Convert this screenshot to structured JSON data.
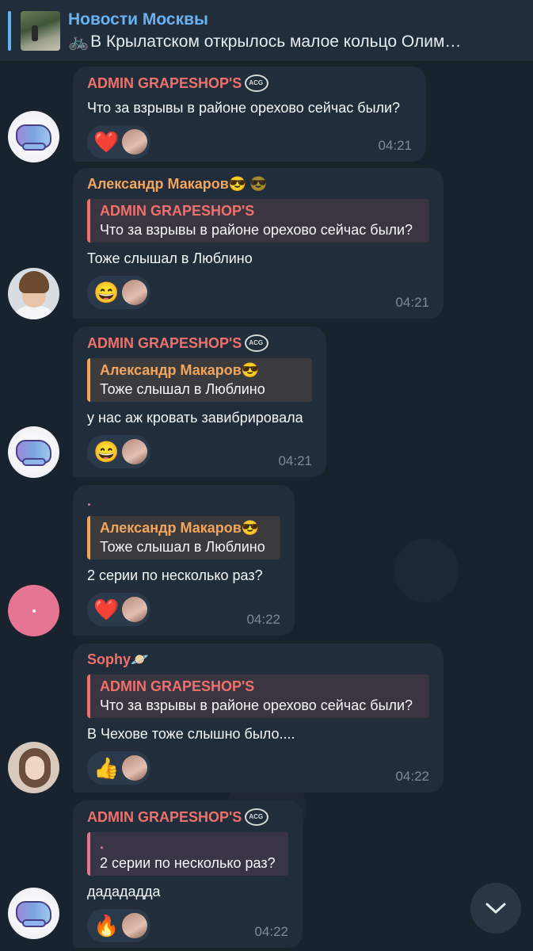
{
  "pinned": {
    "title": "Новости Москвы",
    "subtitle": "В Крылатском открылось малое кольцо Олим…",
    "icon": "bicycle-icon"
  },
  "messages": [
    {
      "sender": "ADMIN GRAPESHOP'S",
      "sender_badge": "acg-logo-icon",
      "text": "Что за взрывы в районе орехово сейчас были?",
      "reply": null,
      "reaction": "❤️",
      "time": "04:21",
      "avatar": "graffiti"
    },
    {
      "sender": "Александр Макаров😎",
      "sender_badge": "sunglasses-emoji-icon",
      "reply": {
        "name": "ADMIN GRAPESHOP'S",
        "text": "Что за взрывы в районе орехово сейчас были?"
      },
      "text": "Тоже слышал в Люблино",
      "reaction": "😄",
      "time": "04:21",
      "avatar": "man"
    },
    {
      "sender": "ADMIN GRAPESHOP'S",
      "sender_badge": "acg-logo-icon",
      "reply": {
        "name": "Александр Макаров😎",
        "text": "Тоже слышал в Люблино"
      },
      "text": "у нас аж кровать завибрировала",
      "reaction": "😄",
      "time": "04:21",
      "avatar": "graffiti"
    },
    {
      "sender": ".",
      "reply": {
        "name": "Александр Макаров😎",
        "text": "Тоже слышал в Люблино"
      },
      "text": "2 серии по несколько раз?",
      "reaction": "❤️",
      "time": "04:22",
      "avatar": "pink"
    },
    {
      "sender": "Sophy🪐",
      "reply": {
        "name": "ADMIN GRAPESHOP'S",
        "text": "Что за взрывы в районе орехово сейчас были?"
      },
      "text": "В Чехове тоже слышно было....",
      "reaction": "👍",
      "time": "04:22",
      "avatar": "girl"
    },
    {
      "sender": "ADMIN GRAPESHOP'S",
      "sender_badge": "acg-logo-icon",
      "reply": {
        "name": ".",
        "text": "2 серии по несколько раз?"
      },
      "text": "дадададда",
      "reaction": "🔥",
      "time": "04:22",
      "avatar": "graffiti"
    }
  ],
  "scroll_button": {
    "icon": "chevron-down-icon"
  },
  "colors": {
    "background": "#19232e",
    "bubble": "#212d3b",
    "accent_blue": "#6ab3f3",
    "name_red": "#f0716a",
    "name_orange": "#f5a55a",
    "name_pink": "#e57593"
  }
}
